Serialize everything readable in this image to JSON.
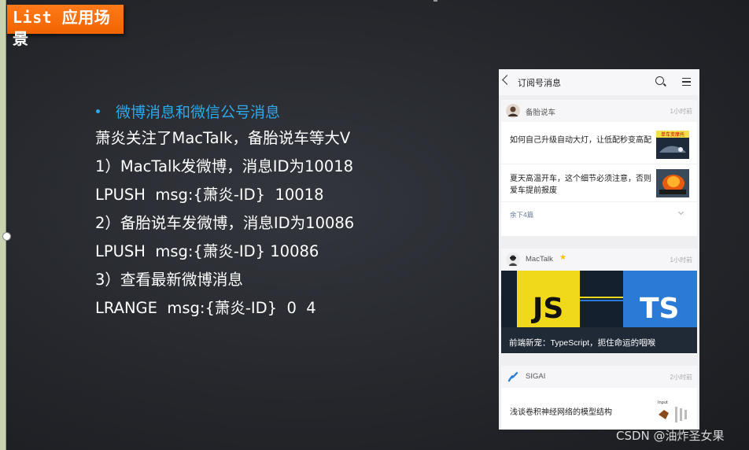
{
  "slide": {
    "title": "List 应用场景",
    "bullet": "微博消息和微信公号消息",
    "lines": [
      "萧炎关注了MacTalk，备胎说车等大V",
      "1）MacTalk发微博，消息ID为10018",
      "LPUSH  msg:{萧炎-ID}  10018",
      "2）备胎说车发微博，消息ID为10086",
      "LPUSH  msg:{萧炎-ID} 10086",
      "3）查看最新微博消息",
      "LRANGE  msg:{萧炎-ID}  0  4"
    ],
    "accent_color": "#2ea8e8",
    "banner_color": "#f06400"
  },
  "phone": {
    "nav_title": "订阅号消息",
    "cards": [
      {
        "name": "备胎说车",
        "time": "1小时前",
        "articles": [
          {
            "title": "如何自己升级自动大灯，让低配秒变高配",
            "thumb_text": "单车变摩托"
          },
          {
            "title": "夏天高温开车，这个细节必须注意，否则爱车提前报废",
            "thumb_text": ""
          }
        ],
        "more": "余下4篇"
      },
      {
        "name": "MacTalk",
        "time": "1小时前",
        "banner_left": "JS",
        "banner_right": "TS",
        "banner_caption": "前端新宠：TypeScript，扼住命运的咽喉"
      },
      {
        "name": "SIGAI",
        "time": "2小时前",
        "articles": [
          {
            "title": "浅谈卷积神经网络的模型结构",
            "thumb_text": "Input"
          }
        ]
      }
    ]
  },
  "watermark": "CSDN @油炸圣女果"
}
